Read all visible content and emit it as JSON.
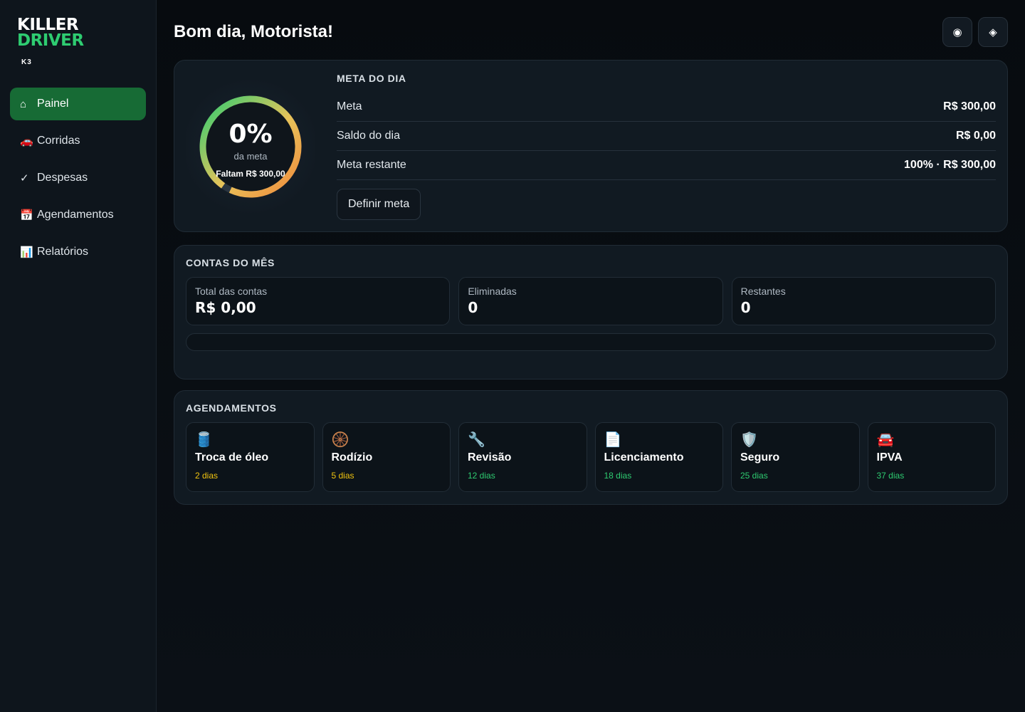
{
  "brand": {
    "line1": "KILLER",
    "line2": "DRIVER",
    "sub": "K3"
  },
  "nav": [
    {
      "icon": "⌂",
      "icon_name": "home-icon",
      "label": "Painel",
      "active": true
    },
    {
      "icon": "🚗",
      "icon_name": "car-icon",
      "label": "Corridas"
    },
    {
      "icon": "✓",
      "icon_name": "check-icon",
      "label": "Despesas"
    },
    {
      "icon": "📅",
      "icon_name": "calendar-icon",
      "label": "Agendamentos"
    },
    {
      "icon": "📊",
      "icon_name": "bar-chart-icon",
      "label": "Relatórios"
    }
  ],
  "header": {
    "greeting": "Bom dia, Motorista!",
    "actions": [
      {
        "icon": "◉",
        "icon_name": "target-icon"
      },
      {
        "icon": "◈",
        "icon_name": "diamond-icon"
      }
    ]
  },
  "meta": {
    "title": "META DO DIA",
    "gauge": {
      "percent": "0%",
      "percent_value": 0,
      "label": "da meta",
      "remaining": "Faltam R$ 300,00"
    },
    "rows": [
      {
        "label": "Meta",
        "value": "R$ 300,00"
      },
      {
        "label": "Saldo do dia",
        "value": "R$ 0,00"
      },
      {
        "label": "Meta restante",
        "value": "100% · R$ 300,00"
      }
    ],
    "button": "Definir meta"
  },
  "contas": {
    "title": "CONTAS DO MÊS",
    "stats": [
      {
        "label": "Total das contas",
        "value": "R$ 0,00"
      },
      {
        "label": "Eliminadas",
        "value": "0"
      },
      {
        "label": "Restantes",
        "value": "0"
      }
    ],
    "progress": 0
  },
  "agenda": {
    "title": "AGENDAMENTOS",
    "items": [
      {
        "icon": "🛢️",
        "icon_name": "oil-barrel-icon",
        "name": "Troca de óleo",
        "days": "2 dias",
        "color": "#f1c40f"
      },
      {
        "icon": "🛞",
        "icon_name": "tire-icon",
        "name": "Rodízio",
        "days": "5 dias",
        "color": "#f1c40f"
      },
      {
        "icon": "🔧",
        "icon_name": "wrench-icon",
        "name": "Revisão",
        "days": "12 dias",
        "color": "#2ecc71"
      },
      {
        "icon": "📄",
        "icon_name": "document-icon",
        "name": "Licenciamento",
        "days": "18 dias",
        "color": "#2ecc71"
      },
      {
        "icon": "🛡️",
        "icon_name": "shield-icon",
        "name": "Seguro",
        "days": "25 dias",
        "color": "#2ecc71"
      },
      {
        "icon": "🚘",
        "icon_name": "car-icon",
        "name": "IPVA",
        "days": "37 dias",
        "color": "#2ecc71"
      }
    ]
  },
  "colors": {
    "accent": "#2ecc71",
    "nav_active": "#176b35",
    "gauge_start": "#2ecc71",
    "gauge_mid": "#e8c35a",
    "gauge_end": "#f08a3c"
  }
}
